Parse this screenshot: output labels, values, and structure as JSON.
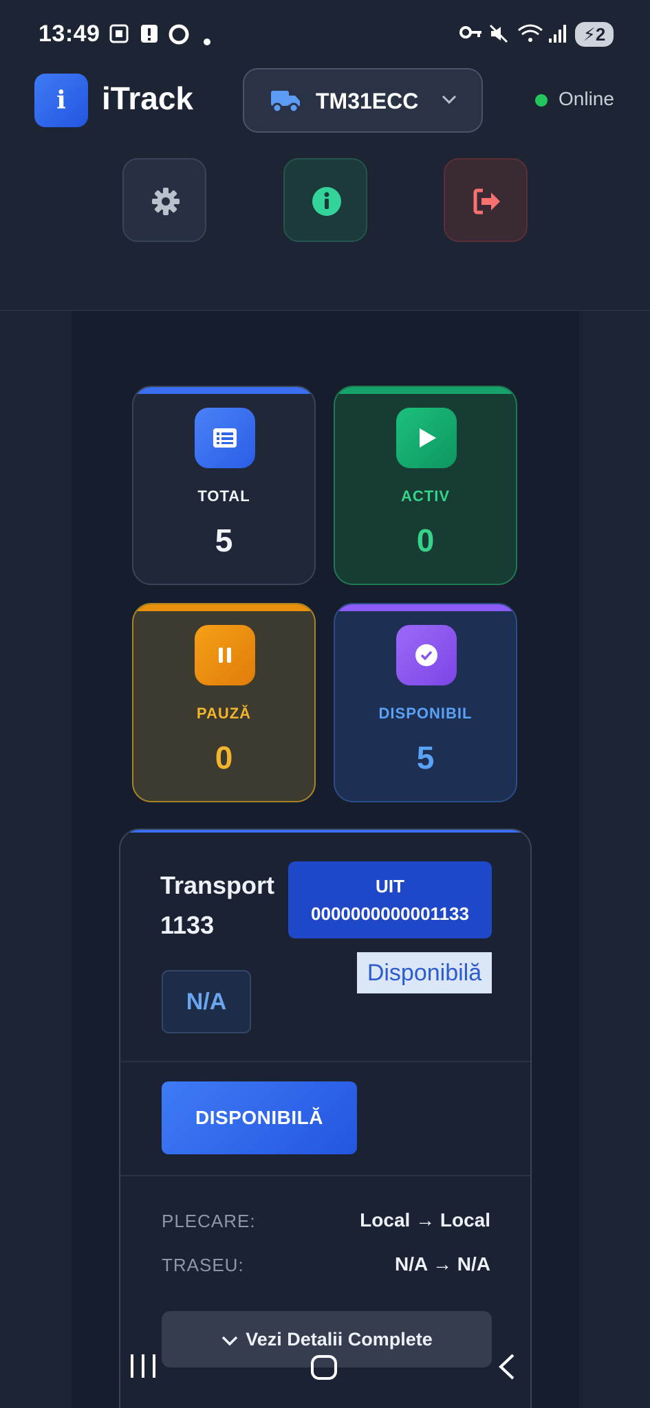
{
  "statusbar": {
    "time": "13:49",
    "battery": "2"
  },
  "header": {
    "logo_letter": "i",
    "app_title": "iTrack",
    "vehicle": {
      "label": "TM31ECC",
      "icon": "truck-icon"
    },
    "connection": {
      "label": "Online",
      "color": "#22c55e"
    },
    "buttons": [
      {
        "name": "settings",
        "icon": "gear-icon"
      },
      {
        "name": "info",
        "icon": "info-icon"
      },
      {
        "name": "logout",
        "icon": "logout-icon"
      }
    ]
  },
  "stats": {
    "total": {
      "label": "TOTAL",
      "value": "5",
      "color": "#3b6ef0"
    },
    "activ": {
      "label": "ACTIV",
      "value": "0",
      "color": "#16a36b"
    },
    "pauza": {
      "label": "PAUZĂ",
      "value": "0",
      "color": "#e6900e"
    },
    "disponibil": {
      "label": "DISPONIBIL",
      "value": "5",
      "color": "#8b5cf6"
    }
  },
  "transport": {
    "title": "Transport 1133",
    "uit_label": "UIT",
    "uit_number": "0000000000001133",
    "status_text": "Disponibilă",
    "vehicle_badge": "N/A",
    "status_button": "DISPONIBILĂ",
    "plecare_label": "PLECARE:",
    "plecare_value": "Local → Local",
    "traseu_label": "TRASEU:",
    "traseu_value": "N/A → N/A",
    "details_button": "Vezi Detalii Complete"
  }
}
